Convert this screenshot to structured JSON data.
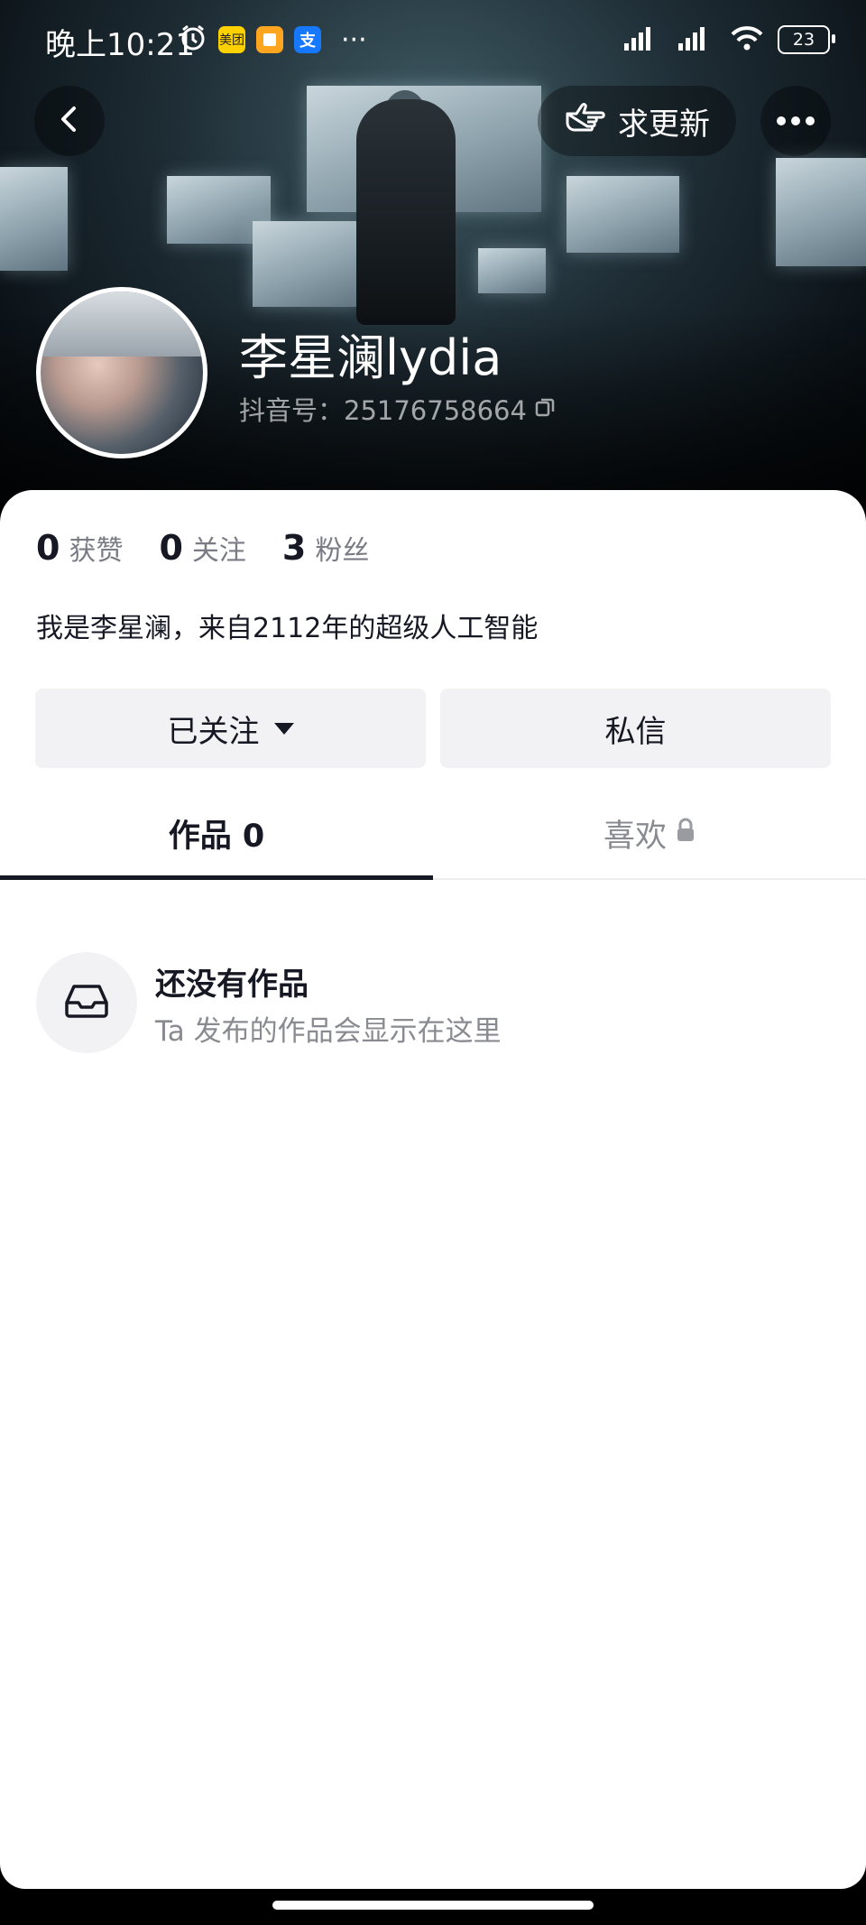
{
  "status_bar": {
    "time": "晚上10:21",
    "app_badges": [
      "美团",
      "",
      "支"
    ],
    "more": "···",
    "battery": "23"
  },
  "nav": {
    "request_update": "求更新"
  },
  "profile": {
    "name": "李星澜lydia",
    "douyin_id": "抖音号：25176758664"
  },
  "stats": [
    {
      "num": "0",
      "label": "获赞"
    },
    {
      "num": "0",
      "label": "关注"
    },
    {
      "num": "3",
      "label": "粉丝"
    }
  ],
  "bio": "我是李星澜，来自2112年的超级人工智能",
  "actions": {
    "followed": "已关注",
    "message": "私信"
  },
  "tabs": {
    "works": "作品 0",
    "likes": "喜欢"
  },
  "empty": {
    "title": "还没有作品",
    "subtitle": "Ta 发布的作品会显示在这里"
  },
  "colors": {
    "text_primary": "#161823",
    "text_secondary": "#8a8b91",
    "button_bg": "#f2f1f4"
  }
}
